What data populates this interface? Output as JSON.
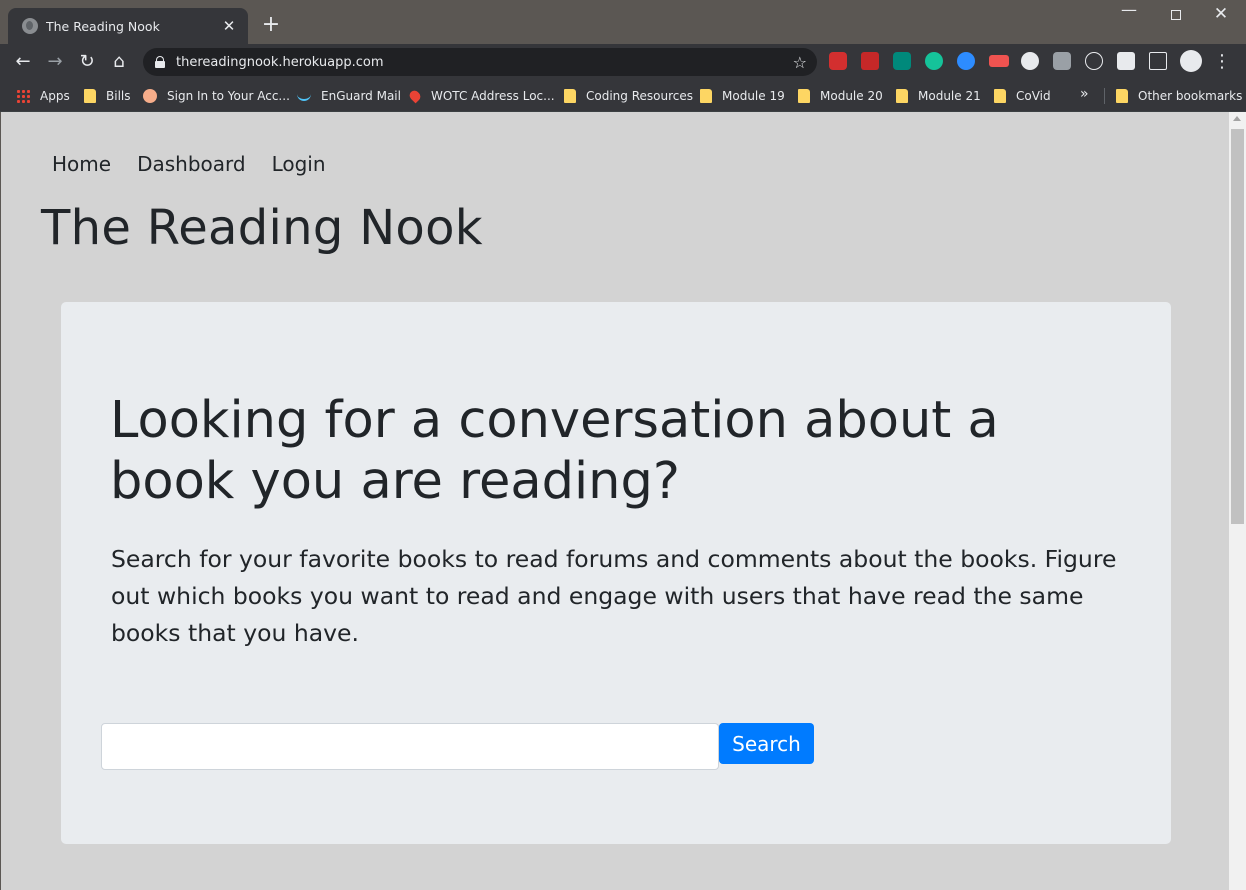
{
  "browser": {
    "tab_title": "The Reading Nook",
    "tab_close": "✕",
    "new_tab": "+",
    "url": "thereadingnook.herokuapp.com",
    "icons": {
      "back": "←",
      "forward": "→",
      "reload": "↻",
      "home": "⌂",
      "star": "☆",
      "menu": "⋮",
      "minimize": "—",
      "close": "✕"
    },
    "bookmarks": [
      {
        "label": "Apps",
        "icon": "apps-grid"
      },
      {
        "label": "Bills",
        "icon": "folder"
      },
      {
        "label": "Sign In to Your Acc...",
        "icon": "site"
      },
      {
        "label": "EnGuard Mail",
        "icon": "site"
      },
      {
        "label": "WOTC Address Loc...",
        "icon": "map-pin"
      },
      {
        "label": "Coding Resources",
        "icon": "folder"
      },
      {
        "label": "Module 19",
        "icon": "folder"
      },
      {
        "label": "Module 20",
        "icon": "folder"
      },
      {
        "label": "Module 21",
        "icon": "folder"
      },
      {
        "label": "CoVid",
        "icon": "folder"
      }
    ],
    "bookmarks_more": "»",
    "other_bookmarks": "Other bookmarks"
  },
  "site": {
    "nav": {
      "home": "Home",
      "dashboard": "Dashboard",
      "login": "Login"
    },
    "title": "The Reading Nook",
    "hero": {
      "heading": "Looking for a conversation about a book you are reading?",
      "text": "Search for your favorite books to read forums and comments about the books.  Figure out which books you want to read and engage with users that have read the same books that you have.",
      "search_value": "",
      "search_button": "Search"
    }
  },
  "colors": {
    "page_bg": "#d3d3d3",
    "jumbotron_bg": "#e9ecef",
    "primary_button": "#007bff",
    "text": "#212529"
  }
}
